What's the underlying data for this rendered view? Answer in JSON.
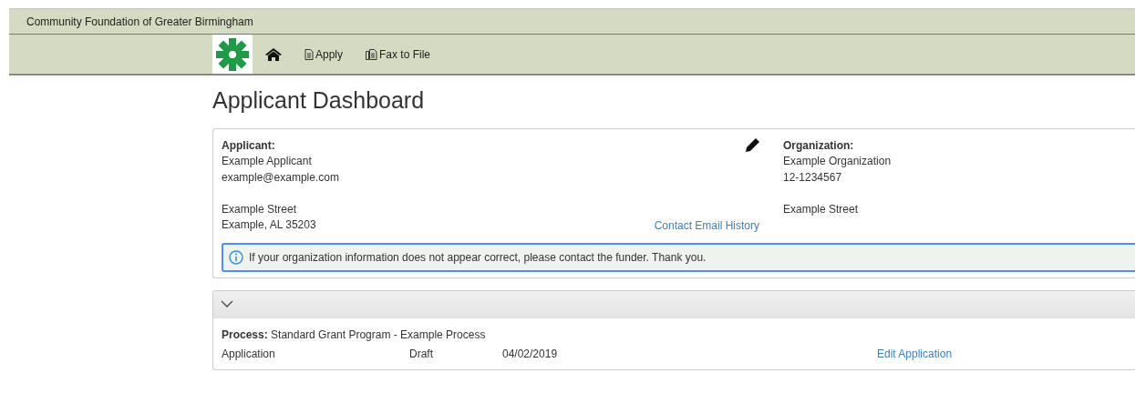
{
  "header": {
    "title": "Community Foundation of Greater Birmingham"
  },
  "nav": {
    "items": [
      {
        "kind": "home"
      },
      {
        "kind": "apply",
        "label": "Apply"
      },
      {
        "kind": "fax",
        "label": "Fax to File"
      }
    ]
  },
  "page_title": "Applicant Dashboard",
  "applicant": {
    "heading": "Applicant:",
    "lines": [
      "Example Applicant",
      "example@example.com"
    ],
    "address": [
      "Example Street",
      "Example, AL 35203"
    ],
    "link": "Contact Email History"
  },
  "organization": {
    "heading": "Organization:",
    "lines": [
      "Example Organization",
      "12-1234567"
    ],
    "address": [
      "Example Street"
    ]
  },
  "notice": "If your organization information does not appear correct, please contact the funder. Thank you.",
  "process": {
    "expanded": true,
    "title": "**Process:** Standard Grant Program - Example Process",
    "rows": [
      {
        "name": "Application",
        "status": "Draft",
        "date": "04/02/2019",
        "action": "Edit Application"
      }
    ]
  }
}
